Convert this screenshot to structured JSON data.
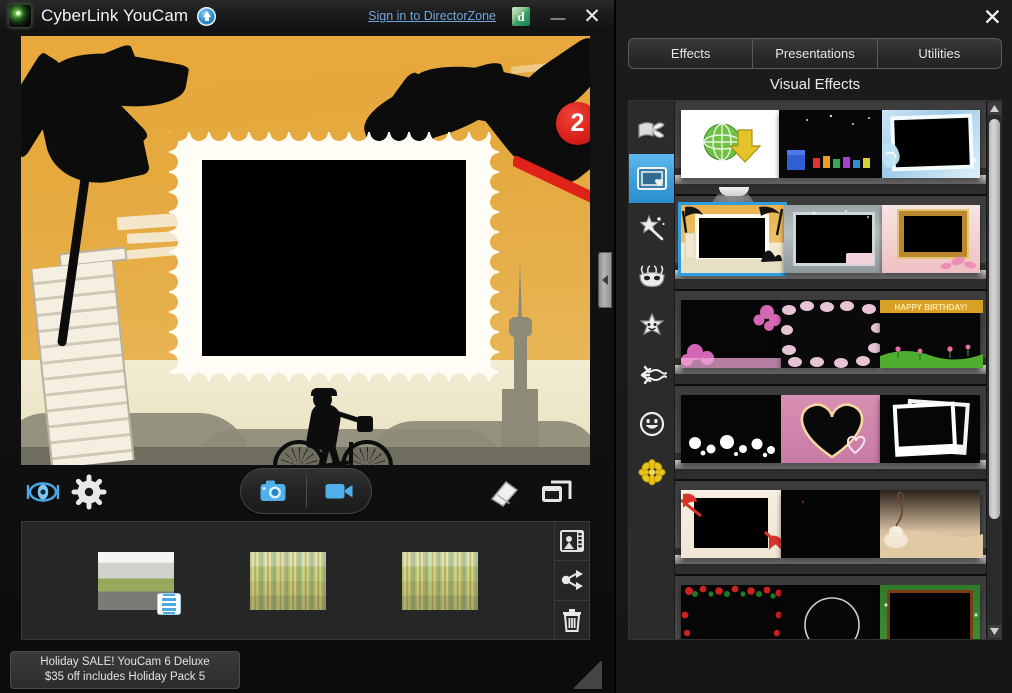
{
  "window": {
    "title": "CyberLink YouCam",
    "logo_icon": "youcam-lens-logo",
    "upgrade_icon": "upgrade-arrow-icon",
    "signin_link": "Sign in to DirectorZone",
    "directorzone_badge": "d",
    "minimize_label": "—",
    "close_label": "✕"
  },
  "preview": {
    "effect_name": "travel-stamp-frame",
    "annotation": {
      "step_number": "2",
      "arrow_icon": "red-arrow-icon"
    },
    "collapse_handle_icon": "chevron-left-icon"
  },
  "capture_bar": {
    "face_login_icon": "face-recognition-icon",
    "settings_icon": "gear-icon",
    "photo_icon": "camera-icon",
    "video_icon": "camcorder-icon",
    "eraser_icon": "eraser-icon",
    "mirror_icon": "dual-preview-icon"
  },
  "filmstrip": {
    "items": [
      {
        "name": "media-thumbnail-1",
        "type": "video",
        "badge_icon": "video-badge-icon"
      },
      {
        "name": "media-thumbnail-2",
        "type": "photo"
      },
      {
        "name": "media-thumbnail-3",
        "type": "photo"
      }
    ],
    "actions": [
      {
        "name": "media-library-button",
        "icon": "media-library-icon"
      },
      {
        "name": "share-button",
        "icon": "share-nodes-icon"
      },
      {
        "name": "delete-button",
        "icon": "trash-icon"
      }
    ]
  },
  "promo": {
    "line1": "Holiday SALE! YouCam 6 Deluxe",
    "line2": "$35 off includes Holiday Pack 5"
  },
  "effects_panel": {
    "close_label": "✕",
    "tabs": [
      {
        "label": "Effects",
        "active": true
      },
      {
        "label": "Presentations",
        "active": false
      },
      {
        "label": "Utilities",
        "active": false
      }
    ],
    "heading": "Visual Effects",
    "categories": [
      {
        "name": "category-gifts",
        "icon": "ribbon-bow-icon",
        "active": false
      },
      {
        "name": "category-frames",
        "icon": "frame-icon",
        "active": true
      },
      {
        "name": "category-distortion",
        "icon": "magic-wand-icon",
        "active": false
      },
      {
        "name": "category-avatars",
        "icon": "mask-icon",
        "active": false
      },
      {
        "name": "category-emotions",
        "icon": "star-face-icon",
        "active": false
      },
      {
        "name": "category-particles",
        "icon": "particles-icon",
        "active": false
      },
      {
        "name": "category-emoticons",
        "icon": "smiley-icon",
        "active": false
      },
      {
        "name": "category-downloaded",
        "icon": "yellow-flower-icon",
        "active": false
      }
    ],
    "rows": [
      {
        "items": [
          {
            "name": "effect-download-more",
            "style": "t-dl",
            "selected": false
          },
          {
            "name": "effect-gift-night",
            "style": "t-gift",
            "selected": false
          },
          {
            "name": "effect-ice-frame",
            "style": "t-ice",
            "selected": false
          }
        ]
      },
      {
        "items": [
          {
            "name": "effect-beach-stamp",
            "style": "t-beach",
            "selected": true
          },
          {
            "name": "effect-steel-frame",
            "style": "t-steel",
            "selected": false
          },
          {
            "name": "effect-gold-frame",
            "style": "t-gold",
            "selected": false
          }
        ]
      },
      {
        "items": [
          {
            "name": "effect-pink-flower",
            "style": "t-pinkfl",
            "selected": false
          },
          {
            "name": "effect-petal-frame",
            "style": "t-petal",
            "selected": false
          },
          {
            "name": "effect-happy-birthday",
            "style": "t-bday",
            "selected": false
          }
        ]
      },
      {
        "items": [
          {
            "name": "effect-bokeh-frame",
            "style": "t-bokeh",
            "selected": false
          },
          {
            "name": "effect-heart-frame",
            "style": "t-heart",
            "selected": false
          },
          {
            "name": "effect-polaroid-frame",
            "style": "t-polaroid",
            "selected": false
          }
        ]
      },
      {
        "items": [
          {
            "name": "effect-ribbon-frame",
            "style": "t-ribbon",
            "selected": false
          },
          {
            "name": "effect-plain-black",
            "style": "t-black",
            "selected": false
          },
          {
            "name": "effect-wedding-frame",
            "style": "t-wed",
            "selected": false
          }
        ]
      },
      {
        "items": [
          {
            "name": "effect-christmas-frame",
            "style": "t-xmas",
            "selected": false
          },
          {
            "name": "effect-ring-frame",
            "style": "t-ring",
            "selected": false
          },
          {
            "name": "effect-green-holiday",
            "style": "t-green",
            "selected": false
          }
        ]
      }
    ],
    "scrollbar": {
      "up_icon": "scroll-up-icon",
      "down_icon": "scroll-down-icon"
    }
  },
  "colors": {
    "accent_blue": "#3d9fdd",
    "annotation_red": "#d61f17",
    "link_blue": "#6fa8dc",
    "panel_bg": "#1c1c1c"
  }
}
